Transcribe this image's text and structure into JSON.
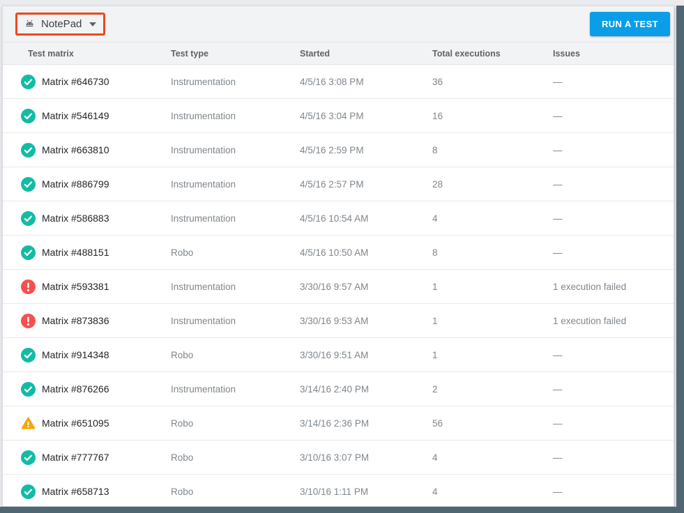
{
  "colors": {
    "success_green": "#12BCA4",
    "error_red": "#F4514E",
    "warning_amber": "#F5A70A",
    "button_blue": "#0A9EE8",
    "annotation_orange": "#EA491E",
    "frame_slate": "#4E6772"
  },
  "icons": {
    "app": "android-icon",
    "dropdown": "caret-down-icon",
    "success": "check-circle-icon",
    "error": "error-circle-icon",
    "warning": "warning-triangle-icon"
  },
  "toolbar": {
    "app_selector": {
      "label": "NotePad"
    },
    "run_test_label": "RUN A TEST"
  },
  "table": {
    "columns": [
      "Test matrix",
      "Test type",
      "Started",
      "Total executions",
      "Issues"
    ],
    "rows": [
      {
        "status": "success",
        "matrix": "Matrix #646730",
        "type": "Instrumentation",
        "started": "4/5/16 3:08 PM",
        "executions": "36",
        "issues": "—"
      },
      {
        "status": "success",
        "matrix": "Matrix #546149",
        "type": "Instrumentation",
        "started": "4/5/16 3:04 PM",
        "executions": "16",
        "issues": "—"
      },
      {
        "status": "success",
        "matrix": "Matrix #663810",
        "type": "Instrumentation",
        "started": "4/5/16 2:59 PM",
        "executions": "8",
        "issues": "—"
      },
      {
        "status": "success",
        "matrix": "Matrix #886799",
        "type": "Instrumentation",
        "started": "4/5/16 2:57 PM",
        "executions": "28",
        "issues": "—"
      },
      {
        "status": "success",
        "matrix": "Matrix #586883",
        "type": "Instrumentation",
        "started": "4/5/16 10:54 AM",
        "executions": "4",
        "issues": "—"
      },
      {
        "status": "success",
        "matrix": "Matrix #488151",
        "type": "Robo",
        "started": "4/5/16 10:50 AM",
        "executions": "8",
        "issues": "—"
      },
      {
        "status": "error",
        "matrix": "Matrix #593381",
        "type": "Instrumentation",
        "started": "3/30/16 9:57 AM",
        "executions": "1",
        "issues": "1 execution failed"
      },
      {
        "status": "error",
        "matrix": "Matrix #873836",
        "type": "Instrumentation",
        "started": "3/30/16 9:53 AM",
        "executions": "1",
        "issues": "1 execution failed"
      },
      {
        "status": "success",
        "matrix": "Matrix #914348",
        "type": "Robo",
        "started": "3/30/16 9:51 AM",
        "executions": "1",
        "issues": "—"
      },
      {
        "status": "success",
        "matrix": "Matrix #876266",
        "type": "Instrumentation",
        "started": "3/14/16 2:40 PM",
        "executions": "2",
        "issues": "—"
      },
      {
        "status": "warning",
        "matrix": "Matrix #651095",
        "type": "Robo",
        "started": "3/14/16 2:36 PM",
        "executions": "56",
        "issues": "—"
      },
      {
        "status": "success",
        "matrix": "Matrix #777767",
        "type": "Robo",
        "started": "3/10/16 3:07 PM",
        "executions": "4",
        "issues": "—"
      },
      {
        "status": "success",
        "matrix": "Matrix #658713",
        "type": "Robo",
        "started": "3/10/16 1:11 PM",
        "executions": "4",
        "issues": "—"
      }
    ]
  }
}
